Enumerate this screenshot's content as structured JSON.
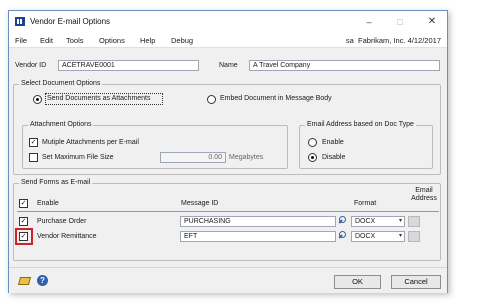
{
  "window": {
    "title": "Vendor E-mail Options",
    "min_glyph": "–",
    "max_glyph": "□",
    "close_glyph": "✕"
  },
  "menu": {
    "items": [
      "File",
      "Edit",
      "Tools",
      "Options",
      "Help",
      "Debug"
    ],
    "user": "sa",
    "company": "Fabrikam, Inc.",
    "date": "4/12/2017"
  },
  "header": {
    "vendor_id_label": "Vendor ID",
    "vendor_id_value": "ACETRAVE0001",
    "name_label": "Name",
    "name_value": "A Travel Company"
  },
  "doc_options": {
    "title": "Select Document Options",
    "send_attachments_label": "Send Documents as Attachments",
    "embed_label": "Embed Document in Message Body",
    "selected": "Send Documents as Attachments"
  },
  "attachment_options": {
    "title": "Attachment Options",
    "multiple_label": "Mutiple Attachments per E-mail",
    "multiple_checked": true,
    "max_size_label": "Set Maximum File Size",
    "max_size_checked": false,
    "max_size_value": "0.00",
    "max_size_unit": "Megabytes"
  },
  "email_address": {
    "title": "Email Address based on Doc Type",
    "enable_label": "Enable",
    "disable_label": "Disable",
    "selected": "Disable"
  },
  "send_forms": {
    "title": "Send Forms as E-mail",
    "col_enable": "Enable",
    "col_message_id": "Message ID",
    "col_format": "Format",
    "col_email_address": "Email Address",
    "rows": [
      {
        "name": "Purchase Order",
        "checked": true,
        "message_id": "PURCHASING",
        "format": "DOCX"
      },
      {
        "name": "Vendor Remittance",
        "checked": true,
        "message_id": "EFT",
        "format": "DOCX"
      }
    ]
  },
  "buttons": {
    "ok": "OK",
    "cancel": "Cancel",
    "help_glyph": "?"
  },
  "glyphs": {
    "check": "✓",
    "dropdown": "▾"
  },
  "icons": [
    "app-icon",
    "note-icon",
    "help-icon",
    "lookup-icon",
    "chevron-down-icon"
  ],
  "colors": {
    "highlight_box": "#cc2229",
    "title_icon": "#1f3f8f",
    "window_bg": "#f0f0f0"
  }
}
